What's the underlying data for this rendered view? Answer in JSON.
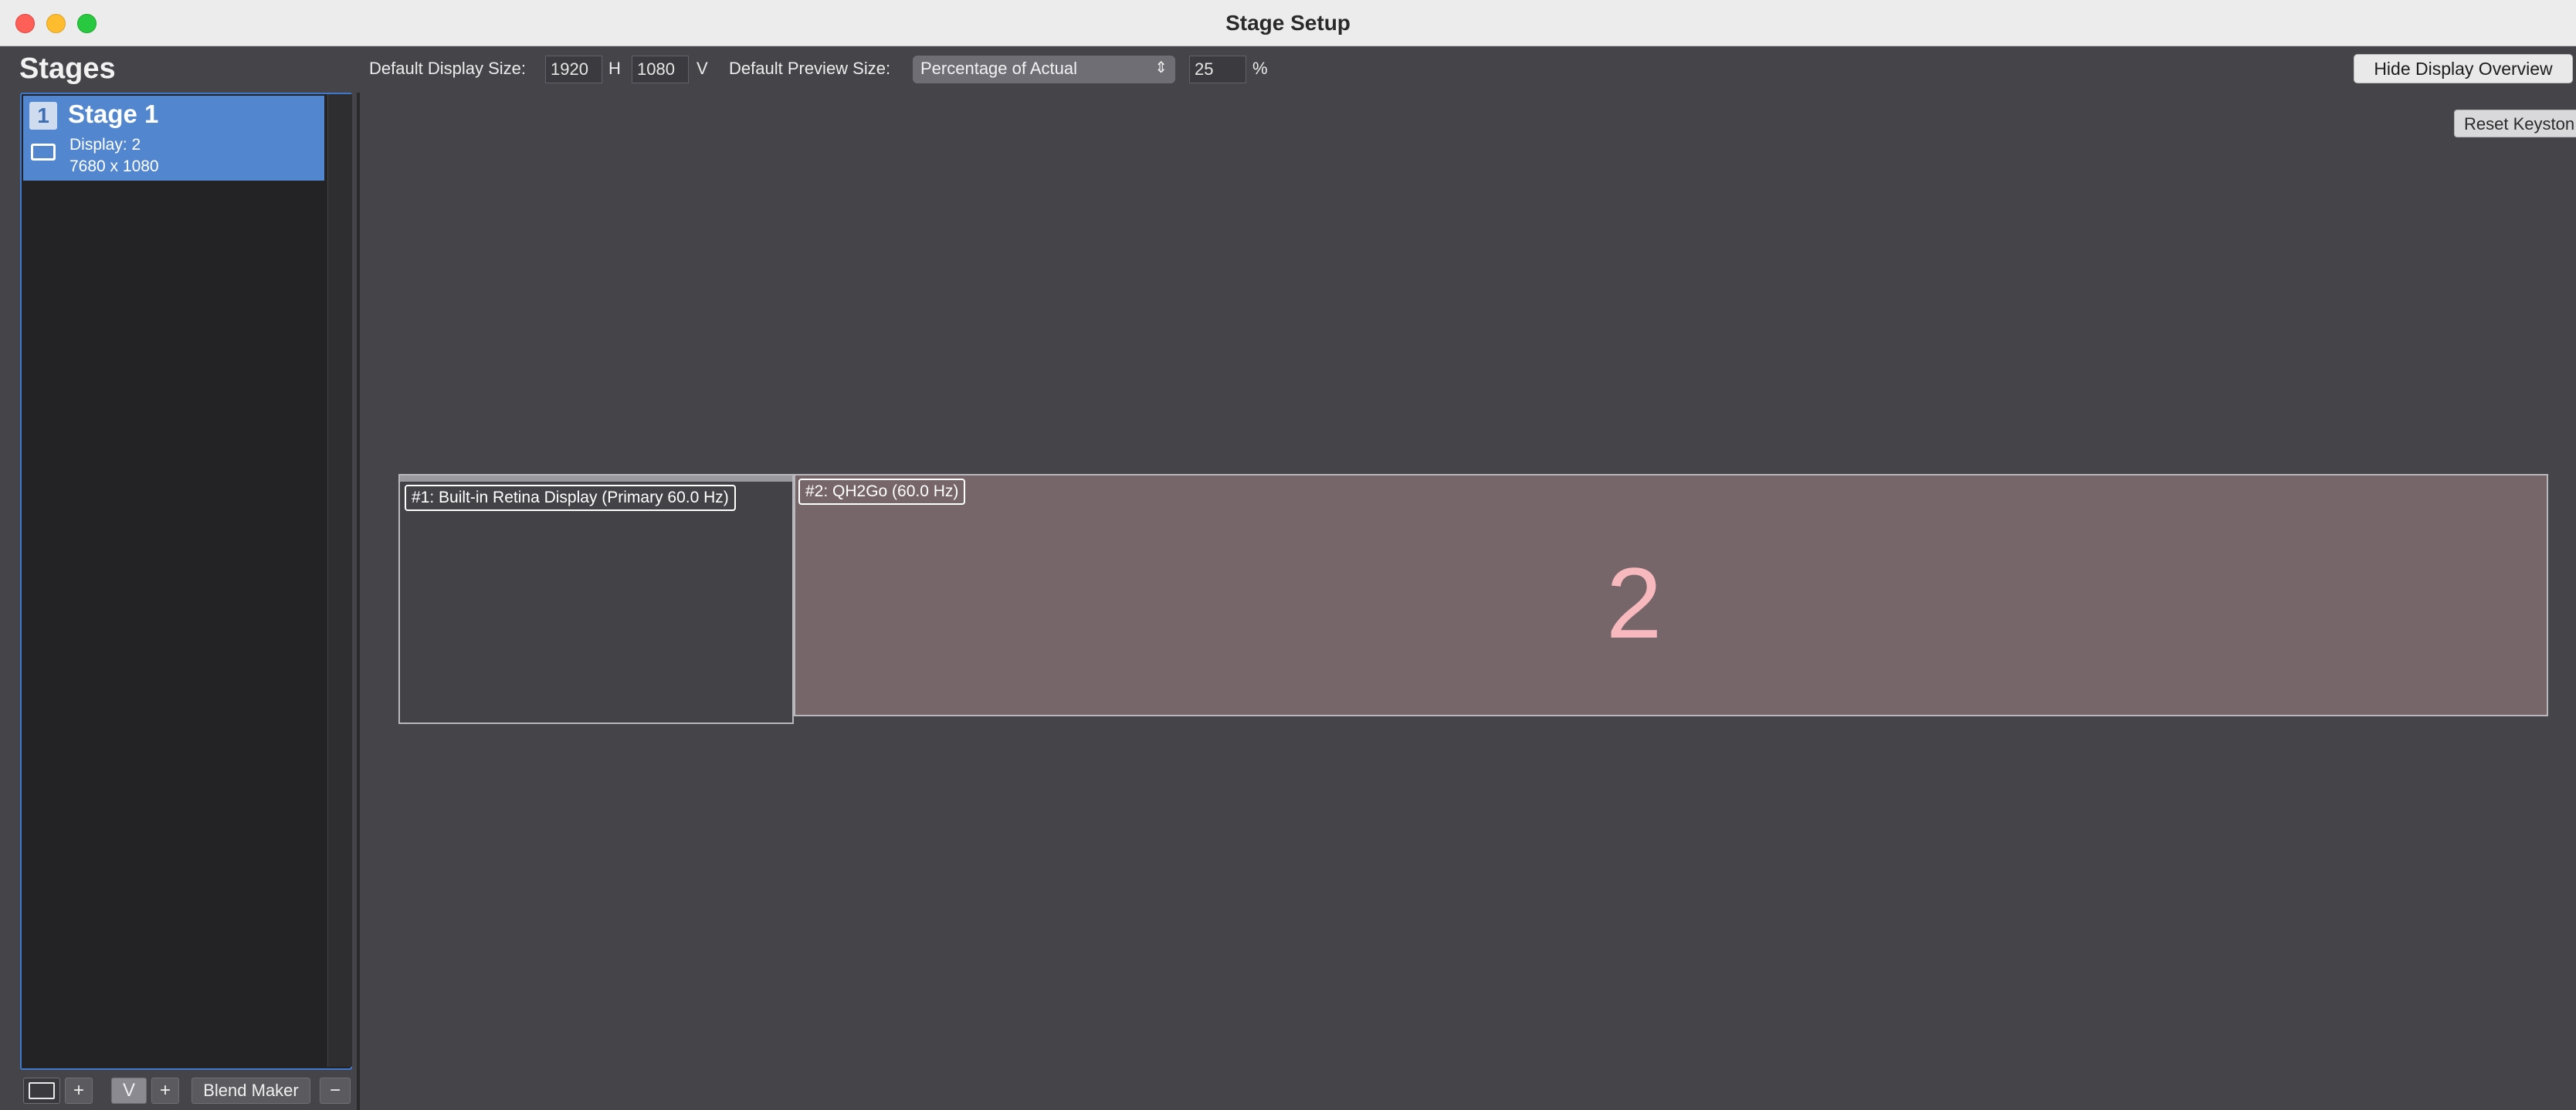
{
  "window": {
    "title": "Stage Setup"
  },
  "toolbar": {
    "stages_heading": "Stages",
    "default_display_size_label": "Default Display Size:",
    "display_width": "1920",
    "h_label": "H",
    "display_height": "1080",
    "v_label": "V",
    "default_preview_size_label": "Default Preview Size:",
    "preview_mode": "Percentage of Actual",
    "preview_percent": "25",
    "percent_sign": "%",
    "hide_display_overview": "Hide Display Overview",
    "reset_keystone": "Reset Keyston"
  },
  "stages": [
    {
      "number": "1",
      "name": "Stage 1",
      "display": "Display: 2",
      "resolution": "7680 x 1080"
    }
  ],
  "bottom_bar": {
    "add": "+",
    "v_label": "V",
    "blend_maker": "Blend Maker",
    "remove": "−"
  },
  "displays": [
    {
      "label": "#1: Built-in Retina Display (Primary 60.0 Hz)"
    },
    {
      "label": "#2: QH2Go (60.0 Hz)",
      "number": "2"
    }
  ],
  "colors": {
    "selection": "#5287cf",
    "background": "#454449",
    "display2_fill": "#76666a",
    "display2_number": "#f8b9be"
  }
}
